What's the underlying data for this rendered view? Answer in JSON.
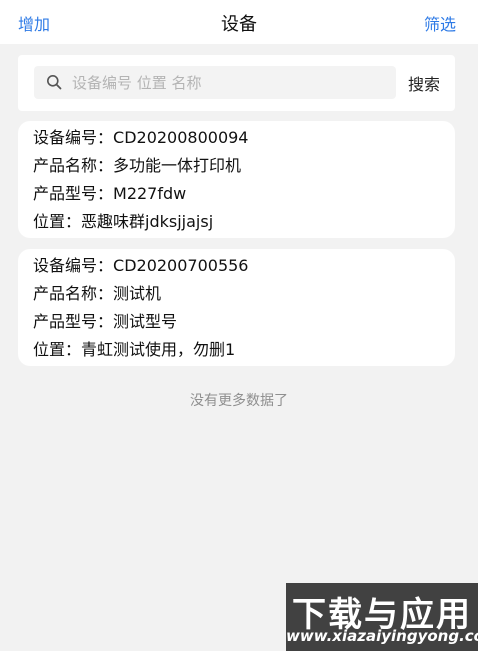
{
  "header": {
    "left_label": "增加",
    "title": "设备",
    "right_label": "筛选"
  },
  "search": {
    "placeholder": "设备编号 位置 名称",
    "value": "",
    "button_label": "搜索",
    "icon": "search-icon"
  },
  "devices": [
    {
      "code_label": "设备编号：",
      "code": "CD20200800094",
      "name_label": "产品名称：",
      "name": "多功能一体打印机",
      "model_label": "产品型号：",
      "model": "M227fdw",
      "location_label": "位置：",
      "location": "恶趣味群jdksjjajsj"
    },
    {
      "code_label": "设备编号：",
      "code": "CD20200700556",
      "name_label": "产品名称：",
      "name": "测试机",
      "model_label": "产品型号：",
      "model": "测试型号",
      "location_label": "位置：",
      "location": "青虹测试使用，勿删1"
    }
  ],
  "list_end_text": "没有更多数据了",
  "watermark": {
    "main": "下载与应用",
    "url": "www.xiazaiyingyong.com"
  },
  "colors": {
    "accent": "#2f7be6",
    "background": "#f2f2f2",
    "card": "#ffffff"
  }
}
